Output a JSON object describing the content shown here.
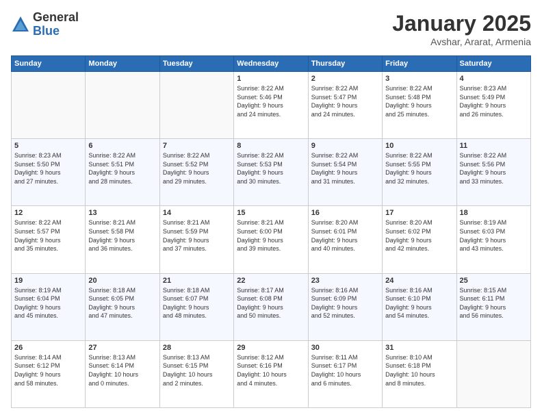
{
  "logo": {
    "general": "General",
    "blue": "Blue"
  },
  "header": {
    "title": "January 2025",
    "location": "Avshar, Ararat, Armenia"
  },
  "weekdays": [
    "Sunday",
    "Monday",
    "Tuesday",
    "Wednesday",
    "Thursday",
    "Friday",
    "Saturday"
  ],
  "weeks": [
    [
      {
        "day": "",
        "info": ""
      },
      {
        "day": "",
        "info": ""
      },
      {
        "day": "",
        "info": ""
      },
      {
        "day": "1",
        "info": "Sunrise: 8:22 AM\nSunset: 5:46 PM\nDaylight: 9 hours\nand 24 minutes."
      },
      {
        "day": "2",
        "info": "Sunrise: 8:22 AM\nSunset: 5:47 PM\nDaylight: 9 hours\nand 24 minutes."
      },
      {
        "day": "3",
        "info": "Sunrise: 8:22 AM\nSunset: 5:48 PM\nDaylight: 9 hours\nand 25 minutes."
      },
      {
        "day": "4",
        "info": "Sunrise: 8:23 AM\nSunset: 5:49 PM\nDaylight: 9 hours\nand 26 minutes."
      }
    ],
    [
      {
        "day": "5",
        "info": "Sunrise: 8:23 AM\nSunset: 5:50 PM\nDaylight: 9 hours\nand 27 minutes."
      },
      {
        "day": "6",
        "info": "Sunrise: 8:22 AM\nSunset: 5:51 PM\nDaylight: 9 hours\nand 28 minutes."
      },
      {
        "day": "7",
        "info": "Sunrise: 8:22 AM\nSunset: 5:52 PM\nDaylight: 9 hours\nand 29 minutes."
      },
      {
        "day": "8",
        "info": "Sunrise: 8:22 AM\nSunset: 5:53 PM\nDaylight: 9 hours\nand 30 minutes."
      },
      {
        "day": "9",
        "info": "Sunrise: 8:22 AM\nSunset: 5:54 PM\nDaylight: 9 hours\nand 31 minutes."
      },
      {
        "day": "10",
        "info": "Sunrise: 8:22 AM\nSunset: 5:55 PM\nDaylight: 9 hours\nand 32 minutes."
      },
      {
        "day": "11",
        "info": "Sunrise: 8:22 AM\nSunset: 5:56 PM\nDaylight: 9 hours\nand 33 minutes."
      }
    ],
    [
      {
        "day": "12",
        "info": "Sunrise: 8:22 AM\nSunset: 5:57 PM\nDaylight: 9 hours\nand 35 minutes."
      },
      {
        "day": "13",
        "info": "Sunrise: 8:21 AM\nSunset: 5:58 PM\nDaylight: 9 hours\nand 36 minutes."
      },
      {
        "day": "14",
        "info": "Sunrise: 8:21 AM\nSunset: 5:59 PM\nDaylight: 9 hours\nand 37 minutes."
      },
      {
        "day": "15",
        "info": "Sunrise: 8:21 AM\nSunset: 6:00 PM\nDaylight: 9 hours\nand 39 minutes."
      },
      {
        "day": "16",
        "info": "Sunrise: 8:20 AM\nSunset: 6:01 PM\nDaylight: 9 hours\nand 40 minutes."
      },
      {
        "day": "17",
        "info": "Sunrise: 8:20 AM\nSunset: 6:02 PM\nDaylight: 9 hours\nand 42 minutes."
      },
      {
        "day": "18",
        "info": "Sunrise: 8:19 AM\nSunset: 6:03 PM\nDaylight: 9 hours\nand 43 minutes."
      }
    ],
    [
      {
        "day": "19",
        "info": "Sunrise: 8:19 AM\nSunset: 6:04 PM\nDaylight: 9 hours\nand 45 minutes."
      },
      {
        "day": "20",
        "info": "Sunrise: 8:18 AM\nSunset: 6:05 PM\nDaylight: 9 hours\nand 47 minutes."
      },
      {
        "day": "21",
        "info": "Sunrise: 8:18 AM\nSunset: 6:07 PM\nDaylight: 9 hours\nand 48 minutes."
      },
      {
        "day": "22",
        "info": "Sunrise: 8:17 AM\nSunset: 6:08 PM\nDaylight: 9 hours\nand 50 minutes."
      },
      {
        "day": "23",
        "info": "Sunrise: 8:16 AM\nSunset: 6:09 PM\nDaylight: 9 hours\nand 52 minutes."
      },
      {
        "day": "24",
        "info": "Sunrise: 8:16 AM\nSunset: 6:10 PM\nDaylight: 9 hours\nand 54 minutes."
      },
      {
        "day": "25",
        "info": "Sunrise: 8:15 AM\nSunset: 6:11 PM\nDaylight: 9 hours\nand 56 minutes."
      }
    ],
    [
      {
        "day": "26",
        "info": "Sunrise: 8:14 AM\nSunset: 6:12 PM\nDaylight: 9 hours\nand 58 minutes."
      },
      {
        "day": "27",
        "info": "Sunrise: 8:13 AM\nSunset: 6:14 PM\nDaylight: 10 hours\nand 0 minutes."
      },
      {
        "day": "28",
        "info": "Sunrise: 8:13 AM\nSunset: 6:15 PM\nDaylight: 10 hours\nand 2 minutes."
      },
      {
        "day": "29",
        "info": "Sunrise: 8:12 AM\nSunset: 6:16 PM\nDaylight: 10 hours\nand 4 minutes."
      },
      {
        "day": "30",
        "info": "Sunrise: 8:11 AM\nSunset: 6:17 PM\nDaylight: 10 hours\nand 6 minutes."
      },
      {
        "day": "31",
        "info": "Sunrise: 8:10 AM\nSunset: 6:18 PM\nDaylight: 10 hours\nand 8 minutes."
      },
      {
        "day": "",
        "info": ""
      }
    ]
  ]
}
